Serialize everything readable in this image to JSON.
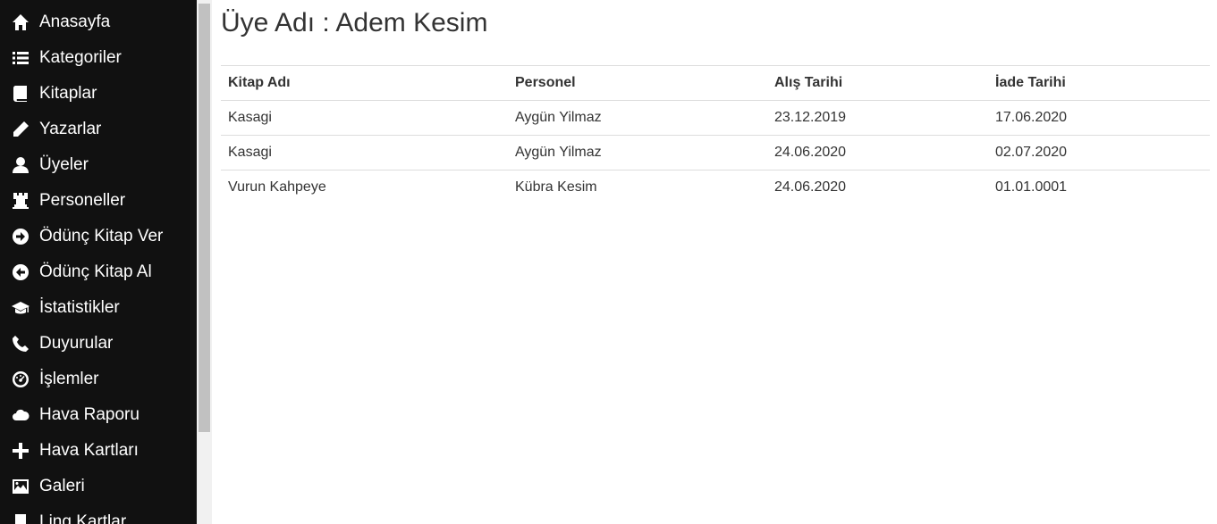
{
  "sidebar": {
    "items": [
      {
        "label": "Anasayfa",
        "icon": "home-icon"
      },
      {
        "label": "Kategoriler",
        "icon": "list-icon"
      },
      {
        "label": "Kitaplar",
        "icon": "book-icon"
      },
      {
        "label": "Yazarlar",
        "icon": "pencil-icon"
      },
      {
        "label": "Üyeler",
        "icon": "user-icon"
      },
      {
        "label": "Personeller",
        "icon": "tower-icon"
      },
      {
        "label": "Ödünç Kitap Ver",
        "icon": "arrow-right-circle-icon"
      },
      {
        "label": "Ödünç Kitap Al",
        "icon": "arrow-left-circle-icon"
      },
      {
        "label": "İstatistikler",
        "icon": "graduation-cap-icon"
      },
      {
        "label": "Duyurular",
        "icon": "phone-icon"
      },
      {
        "label": "İşlemler",
        "icon": "dashboard-icon"
      },
      {
        "label": "Hava Raporu",
        "icon": "cloud-icon"
      },
      {
        "label": "Hava Kartları",
        "icon": "plus-icon"
      },
      {
        "label": "Galeri",
        "icon": "picture-icon"
      },
      {
        "label": "Linq Kartlar",
        "icon": "bookmark-icon"
      }
    ]
  },
  "main": {
    "title": "Üye Adı : Adem Kesim",
    "table": {
      "headers": [
        "Kitap Adı",
        "Personel",
        "Alış Tarihi",
        "İade Tarihi"
      ],
      "rows": [
        [
          "Kasagi",
          "Aygün Yilmaz",
          "23.12.2019",
          "17.06.2020"
        ],
        [
          "Kasagi",
          "Aygün Yilmaz",
          "24.06.2020",
          "02.07.2020"
        ],
        [
          "Vurun Kahpeye",
          "Kübra Kesim",
          "24.06.2020",
          "01.01.0001"
        ]
      ]
    }
  }
}
